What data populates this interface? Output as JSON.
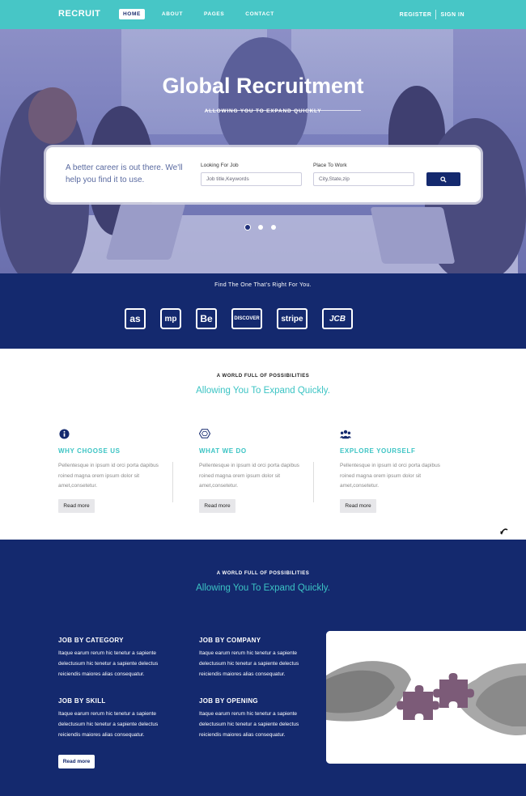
{
  "nav": {
    "logo": "RECRUIT",
    "items": [
      {
        "label": "HOME",
        "active": true
      },
      {
        "label": "ABOUT",
        "active": false
      },
      {
        "label": "PAGES",
        "active": false
      },
      {
        "label": "CONTACT",
        "active": false
      }
    ],
    "register": "REGISTER",
    "signin": "SIGN IN"
  },
  "hero": {
    "title": "Global Recruitment",
    "subtitle": "ALLOWING YOU TO EXPAND QUICKLY",
    "search": {
      "tagline": "A better career is out there. We'll help you find it to use.",
      "job_label": "Looking For Job",
      "job_placeholder": "Job title,Keywords",
      "place_label": "Place To Work",
      "place_placeholder": "City,State,zip",
      "button_icon": "search-icon"
    },
    "slides": 3,
    "active_slide": 1
  },
  "brands": {
    "title": "Find The One That's Right For You.",
    "items": [
      {
        "name": "lastfm",
        "label": "as"
      },
      {
        "name": "mp",
        "label": "mp"
      },
      {
        "name": "behance",
        "label": "Be"
      },
      {
        "name": "discover",
        "label": "DISCOVER"
      },
      {
        "name": "stripe",
        "label": "stripe"
      },
      {
        "name": "jcb",
        "label": "JCB"
      }
    ]
  },
  "features": {
    "kicker": "A WORLD FULL OF POSSIBILITIES",
    "heading": "Allowing You To Expand Quickly.",
    "items": [
      {
        "icon": "info-icon",
        "title": "WHY CHOOSE US",
        "text": "Pellentesque in ipsum id orci porta dapibus roined magna orem ipsum dolor sit amet,consetetur.",
        "button": "Read more"
      },
      {
        "icon": "hexagon-icon",
        "title": "WHAT WE DO",
        "text": "Pellentesque in ipsum id orci porta dapibus roined magna orem ipsum dolor sit amet,consetetur.",
        "button": "Read more"
      },
      {
        "icon": "users-icon",
        "title": "EXPLORE YOURSELF",
        "text": "Pellentesque in ipsum id orci porta dapibus roined magna orem ipsum dolor sit amet,consetetur.",
        "button": "Read more"
      }
    ]
  },
  "jobs": {
    "kicker": "A WORLD FULL OF POSSIBILITIES",
    "heading": "Allowing You To Expand Quickly.",
    "items": [
      {
        "title": "JOB BY CATEGORY",
        "text": "Itaque earum rerum hic tenetur a sapiente delectusum hic tenetur a sapiente delectus reiciendis maiores alias consequatur."
      },
      {
        "title": "JOB BY COMPANY",
        "text": "Itaque earum rerum hic tenetur a sapiente delectusum hic tenetur a sapiente delectus reiciendis maiores alias consequatur."
      },
      {
        "title": "JOB BY SKILL",
        "text": "Itaque earum rerum hic tenetur a sapiente delectusum hic tenetur a sapiente delectus reiciendis maiores alias consequatur."
      },
      {
        "title": "JOB BY OPENING",
        "text": "Itaque earum rerum hic tenetur a sapiente delectusum hic tenetur a sapiente delectus reiciendis maiores alias consequatur."
      }
    ],
    "button": "Read more"
  },
  "colors": {
    "teal": "#47c6c6",
    "navy": "#14296e",
    "accent_text": "#3cc4c4"
  }
}
